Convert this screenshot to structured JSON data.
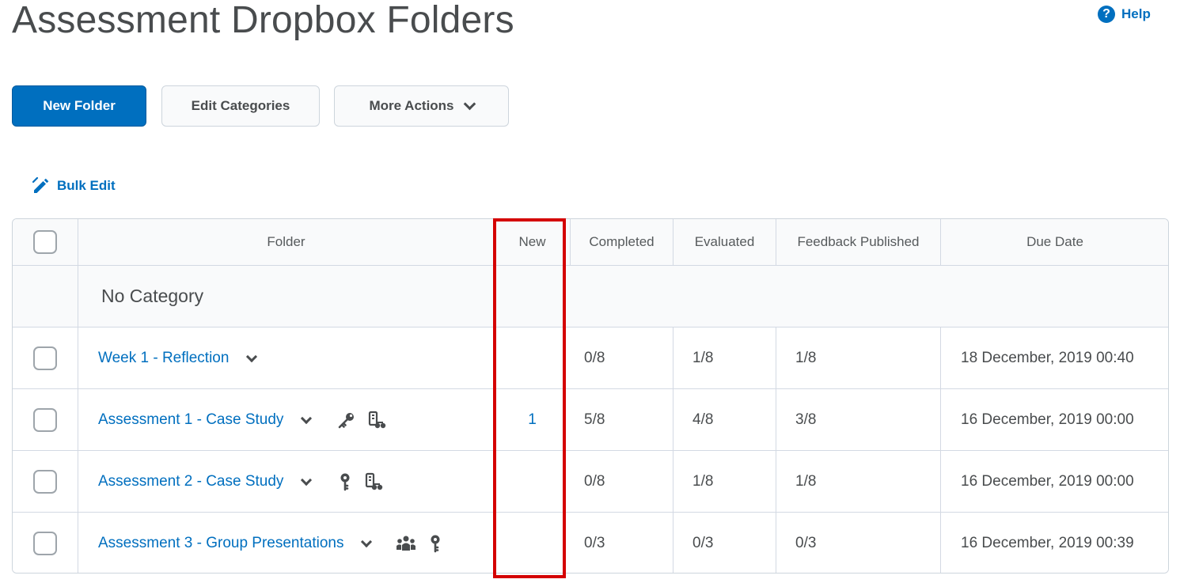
{
  "page": {
    "title": "Assessment Dropbox Folders",
    "help_label": "Help"
  },
  "toolbar": {
    "new_folder": "New Folder",
    "edit_categories": "Edit Categories",
    "more_actions": "More Actions"
  },
  "bulk_edit": "Bulk Edit",
  "table": {
    "columns": [
      "Folder",
      "New",
      "Completed",
      "Evaluated",
      "Feedback Published",
      "Due Date"
    ],
    "category": "No Category",
    "rows": [
      {
        "folder": "Week 1 - Reflection",
        "new": "",
        "completed": "0/8",
        "evaluated": "1/8",
        "feedback": "1/8",
        "due": "18 December, 2019 00:40",
        "icons": []
      },
      {
        "folder": "Assessment 1 - Case Study",
        "new": "1",
        "completed": "5/8",
        "evaluated": "4/8",
        "feedback": "3/8",
        "due": "16 December, 2019 00:00",
        "icons": [
          "key-icon",
          "special-access-icon"
        ]
      },
      {
        "folder": "Assessment 2 - Case Study",
        "new": "",
        "completed": "0/8",
        "evaluated": "1/8",
        "feedback": "1/8",
        "due": "16 December, 2019 00:00",
        "icons": [
          "release-condition-icon",
          "special-access-icon"
        ]
      },
      {
        "folder": "Assessment 3 - Group Presentations",
        "new": "",
        "completed": "0/3",
        "evaluated": "0/3",
        "feedback": "0/3",
        "due": "16 December, 2019 00:39",
        "icons": [
          "group-icon",
          "release-condition-icon"
        ]
      }
    ]
  },
  "colors": {
    "accent": "#006fbf",
    "highlight": "#d40000"
  }
}
